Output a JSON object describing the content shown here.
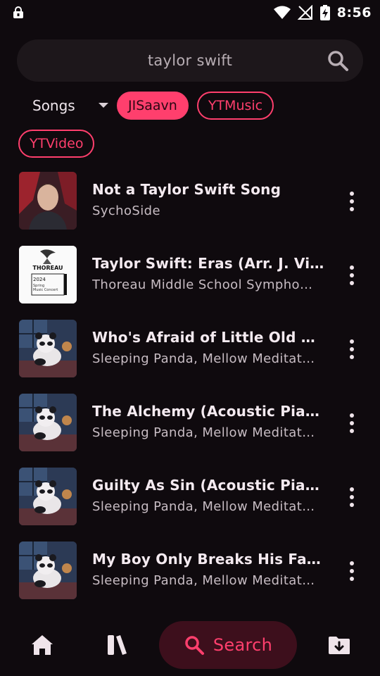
{
  "status_bar": {
    "time": "8:56"
  },
  "search": {
    "query": "taylor swift"
  },
  "filters": {
    "dropdown_label": "Songs",
    "chips": [
      {
        "label": "JISaavn",
        "active": true
      },
      {
        "label": "YTMusic",
        "active": false
      },
      {
        "label": "YTVideo",
        "active": false
      }
    ]
  },
  "songs": [
    {
      "title": "Not a Taylor Swift Song",
      "artist": "SychoSide",
      "thumb": "portrait"
    },
    {
      "title": "Taylor Swift: Eras (Arr. J. Vinso…",
      "artist": "Thoreau Middle School Sympho…",
      "thumb": "doc",
      "thumb_text": {
        "title": "THOREAU",
        "year": "2024",
        "line1": "Spring",
        "line2": "Music Concert"
      }
    },
    {
      "title": "Who's Afraid of Little Old Me (…",
      "artist": "Sleeping Panda, Mellow Meditat…",
      "thumb": "panda"
    },
    {
      "title": "The Alchemy (Acoustic Piano …",
      "artist": "Sleeping Panda, Mellow Meditat…",
      "thumb": "panda"
    },
    {
      "title": "Guilty As Sin (Acoustic Piano …",
      "artist": "Sleeping Panda, Mellow Meditat…",
      "thumb": "panda"
    },
    {
      "title": "My Boy Only Breaks His Favori…",
      "artist": "Sleeping Panda, Mellow Meditat…",
      "thumb": "panda"
    }
  ],
  "bottom_nav": {
    "items": [
      {
        "icon": "home-icon"
      },
      {
        "icon": "library-icon"
      },
      {
        "icon": "search-icon",
        "label": "Search",
        "active": true
      },
      {
        "icon": "downloads-icon"
      }
    ]
  },
  "colors": {
    "accent": "#ff3f6d",
    "background": "#0f0a0e",
    "surface": "#1d171b",
    "active_nav_bg": "#3d0f1c"
  }
}
